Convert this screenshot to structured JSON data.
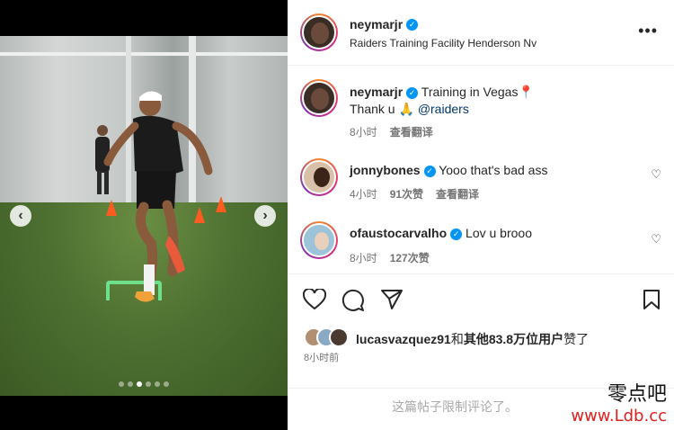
{
  "post": {
    "author": "neymarjr",
    "location": "Raiders Training Facility Henderson Nv",
    "more_icon": "more-horizontal-icon",
    "caption_line1": "Training in Vegas📍",
    "caption_line2_prefix": "Thank u 🙏",
    "caption_mention": "@raiders",
    "caption_time": "8小时",
    "caption_translate": "查看翻译"
  },
  "media": {
    "slide_count": 6,
    "active_slide": 3,
    "prev_label": "‹",
    "next_label": "›"
  },
  "comments": [
    {
      "user": "jonnybones",
      "text": "Yooo that's bad ass",
      "time": "4小时",
      "likes": "91次赞",
      "translate": "查看翻译"
    },
    {
      "user": "ofaustocarvalho",
      "text": "Lov u brooo",
      "time": "8小时",
      "likes": "127次赞"
    }
  ],
  "likes": {
    "user": "lucasvazquez91",
    "and": "和",
    "others": "其他83.8万位用户",
    "suffix": "赞了"
  },
  "post_time": "8小时前",
  "comments_closed": "这篇帖子限制评论了。",
  "watermark": {
    "text": "零点吧",
    "url": "www.Ldb.cc"
  },
  "colors": {
    "verified": "#0095f6",
    "cone": "#ff5a1f",
    "watermark_url": "#e02020"
  }
}
